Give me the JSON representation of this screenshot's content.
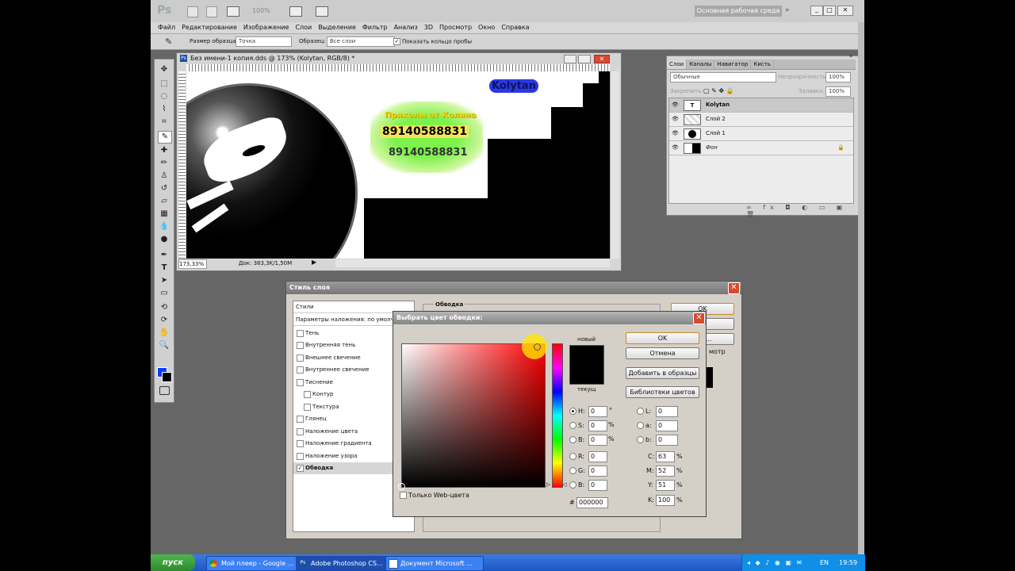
{
  "app": {
    "logo": "Ps",
    "workspace": "Основная рабочая среда",
    "zoom": "100%"
  },
  "menu": [
    "Файл",
    "Редактирование",
    "Изображение",
    "Слои",
    "Выделение",
    "Фильтр",
    "Анализ",
    "3D",
    "Просмотр",
    "Окно",
    "Справка"
  ],
  "options": {
    "sample_size_label": "Размер образца:",
    "sample_size_value": "Точка",
    "sample_label": "Образец:",
    "sample_value": "Все слои",
    "ring_label": "Показать кольцо пробы"
  },
  "document": {
    "title": "Без имени-1 копия.dds @ 173% (Kolytan, RGB/8) *",
    "zoom": "173,33%",
    "doc_info": "Док: 383,3K/1,50M",
    "canvas_text1": "Приколы от Колина",
    "canvas_text2": "89140588831",
    "canvas_text3": "89140588831",
    "canvas_text4": "Kolytan"
  },
  "layers_panel": {
    "tabs": [
      "Слои",
      "Каналы",
      "Навигатор",
      "Кисть"
    ],
    "blend_mode": "Обычные",
    "opacity_label": "Непрозрачность:",
    "opacity": "100%",
    "lock_label": "Закрепить:",
    "fill_label": "Заливка:",
    "fill": "100%",
    "layers": [
      {
        "name": "Kolytan"
      },
      {
        "name": "Слой 2"
      },
      {
        "name": "Слой 1"
      },
      {
        "name": "Фон"
      }
    ]
  },
  "layer_style": {
    "title": "Стиль слоя",
    "section": "Обводка",
    "ok": "OK",
    "cancel_partial": "на",
    "add_partial": "иль...",
    "preview_partial": "мотр",
    "items": [
      {
        "label": "Стили",
        "checked": false,
        "has_cb": false
      },
      {
        "label": "Параметры наложения: по умолчан",
        "checked": false,
        "has_cb": false
      },
      {
        "label": "Тень",
        "checked": false,
        "has_cb": true
      },
      {
        "label": "Внутренняя тень",
        "checked": false,
        "has_cb": true
      },
      {
        "label": "Внешнее свечение",
        "checked": false,
        "has_cb": true
      },
      {
        "label": "Внутреннее свечение",
        "checked": false,
        "has_cb": true
      },
      {
        "label": "Тиснение",
        "checked": false,
        "has_cb": true
      },
      {
        "label": "Контур",
        "checked": false,
        "has_cb": true
      },
      {
        "label": "Текстура",
        "checked": false,
        "has_cb": true
      },
      {
        "label": "Глянец",
        "checked": false,
        "has_cb": true
      },
      {
        "label": "Наложение цвета",
        "checked": false,
        "has_cb": true
      },
      {
        "label": "Наложение градиента",
        "checked": false,
        "has_cb": true
      },
      {
        "label": "Наложение узора",
        "checked": false,
        "has_cb": true
      },
      {
        "label": "Обводка",
        "checked": true,
        "has_cb": true
      }
    ]
  },
  "color_picker": {
    "title": "Выбрать цвет обводки:",
    "ok": "OK",
    "cancel": "Отмена",
    "add_swatches": "Добавить в образцы",
    "libraries": "Библиотеки цветов",
    "new_label": "новый",
    "current_label": "текущ",
    "web_only": "Только Web-цвета",
    "H": "0",
    "S": "0",
    "B": "0",
    "R": "0",
    "G": "0",
    "Bl": "0",
    "L": "0",
    "a": "0",
    "b": "0",
    "C": "63",
    "M": "52",
    "Y": "51",
    "K": "100",
    "hex": "000000",
    "deg": "°",
    "pct": "%",
    "labels": {
      "H": "H:",
      "S": "S:",
      "B": "B:",
      "R": "R:",
      "G": "G:",
      "Bl": "B:",
      "L": "L:",
      "a": "a:",
      "b": "b:",
      "C": "C:",
      "M": "M:",
      "Y": "Y:",
      "K": "K:",
      "hash": "#"
    }
  },
  "taskbar": {
    "start": "пуск",
    "tasks": [
      "Мой плеер - Google ...",
      "Adobe Photoshop CS...",
      "Документ Microsoft ..."
    ],
    "clock": "19:59",
    "lang": "EN"
  },
  "colors": {
    "accent_close": "#d64a30",
    "fg": "#0a3cff",
    "taskbar": "#1e55c4"
  }
}
